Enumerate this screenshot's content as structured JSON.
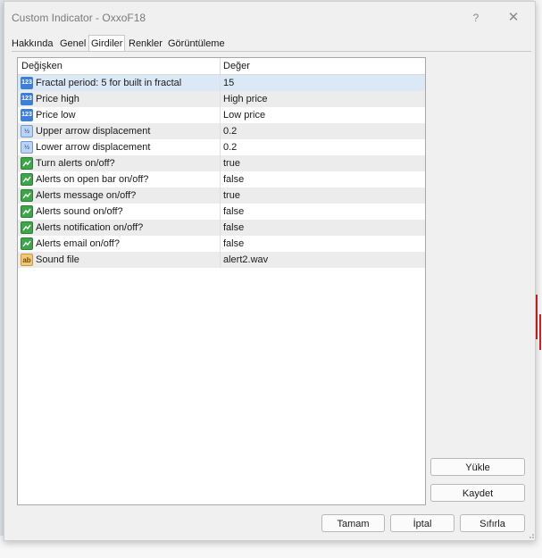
{
  "window": {
    "title": "Custom Indicator - OxxoF18",
    "help_glyph": "?",
    "close_glyph": "✕"
  },
  "tabs": [
    {
      "label": "Hakkında"
    },
    {
      "label": "Genel"
    },
    {
      "label": "Girdiler"
    },
    {
      "label": "Renkler"
    },
    {
      "label": "Görüntüleme"
    }
  ],
  "grid": {
    "header_variable": "Değişken",
    "header_value": "Değer",
    "rows": [
      {
        "icon": "int",
        "icon_text": "123",
        "name": "Fractal period: 5 for built in fractal",
        "value": "15"
      },
      {
        "icon": "int",
        "icon_text": "123",
        "name": "Price high",
        "value": "High price"
      },
      {
        "icon": "int",
        "icon_text": "123",
        "name": "Price low",
        "value": "Low price"
      },
      {
        "icon": "double",
        "icon_text": "½",
        "name": "Upper arrow displacement",
        "value": "0.2"
      },
      {
        "icon": "double",
        "icon_text": "½",
        "name": "Lower arrow displacement",
        "value": "0.2"
      },
      {
        "icon": "bool",
        "icon_text": "",
        "name": "Turn alerts on/off?",
        "value": "true"
      },
      {
        "icon": "bool",
        "icon_text": "",
        "name": "Alerts on open bar on/off?",
        "value": "false"
      },
      {
        "icon": "bool",
        "icon_text": "",
        "name": "Alerts message on/off?",
        "value": "true"
      },
      {
        "icon": "bool",
        "icon_text": "",
        "name": "Alerts sound on/off?",
        "value": "false"
      },
      {
        "icon": "bool",
        "icon_text": "",
        "name": "Alerts notification on/off?",
        "value": "false"
      },
      {
        "icon": "bool",
        "icon_text": "",
        "name": "Alerts email on/off?",
        "value": "false"
      },
      {
        "icon": "string",
        "icon_text": "ab",
        "name": "Sound file",
        "value": "alert2.wav"
      }
    ]
  },
  "side_buttons": {
    "load": "Yükle",
    "save": "Kaydet"
  },
  "footer_buttons": {
    "ok": "Tamam",
    "cancel": "İptal",
    "reset": "Sıfırla"
  },
  "colors": {
    "selected_row": "#dbe9f7",
    "int_icon": "#3d7fd6",
    "bool_icon": "#3fa54a",
    "string_icon": "#f1c87b"
  }
}
